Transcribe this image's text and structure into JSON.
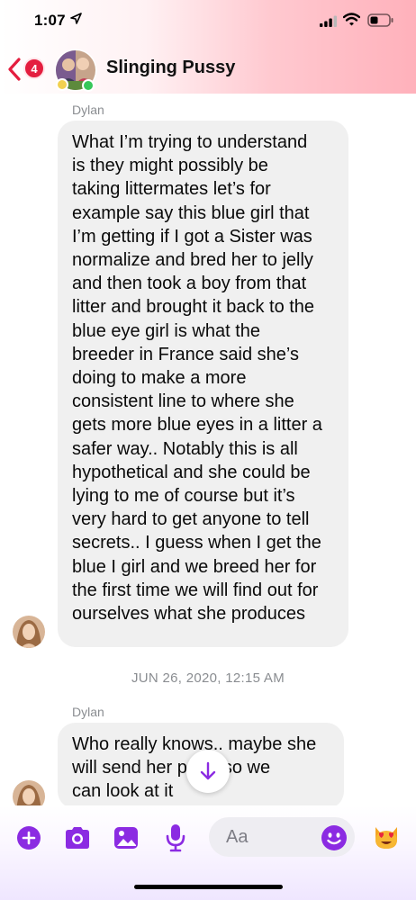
{
  "status_bar": {
    "time": "1:07"
  },
  "header": {
    "unread_count": "4",
    "title": "Slinging Pussy"
  },
  "messages": [
    {
      "sender": "Dylan",
      "text": "What I’m trying to understand\nis they might possibly be\ntaking littermates let’s for\nexample say this blue girl that\nI’m getting if I got a Sister was\nnormalize and bred her to jelly\nand then took a boy from that\nlitter and brought it back to the\nblue eye girl is what the\nbreeder in France said she’s\ndoing to make a more\nconsistent line to where she\ngets more blue eyes in a litter a\nsafer way.. Notably this is all\nhypothetical and she could be\nlying to me of course but it’s\nvery hard to get anyone to tell\nsecrets.. I guess when I get the\nblue I girl and we breed her for\nthe first time we will find out for\nourselves what she produces"
    },
    {
      "sender": "Dylan",
      "text": "Who really knows.. maybe she\nwill send her p        ree so we\ncan look at it"
    }
  ],
  "timestamp": "JUN 26, 2020, 12:15 AM",
  "composer": {
    "placeholder": "Aa"
  },
  "colors": {
    "accent": "#8b2be2",
    "badge": "#e41e3f",
    "bubble": "#f0f0f0"
  },
  "icons": {
    "status": [
      "location-arrow-icon",
      "signal-icon",
      "wifi-icon",
      "battery-icon"
    ],
    "composer": [
      "plus-icon",
      "camera-icon",
      "photo-icon",
      "microphone-icon",
      "emoji-icon",
      "heart-eyes-cat-icon"
    ],
    "scroll": "arrow-down-icon"
  }
}
